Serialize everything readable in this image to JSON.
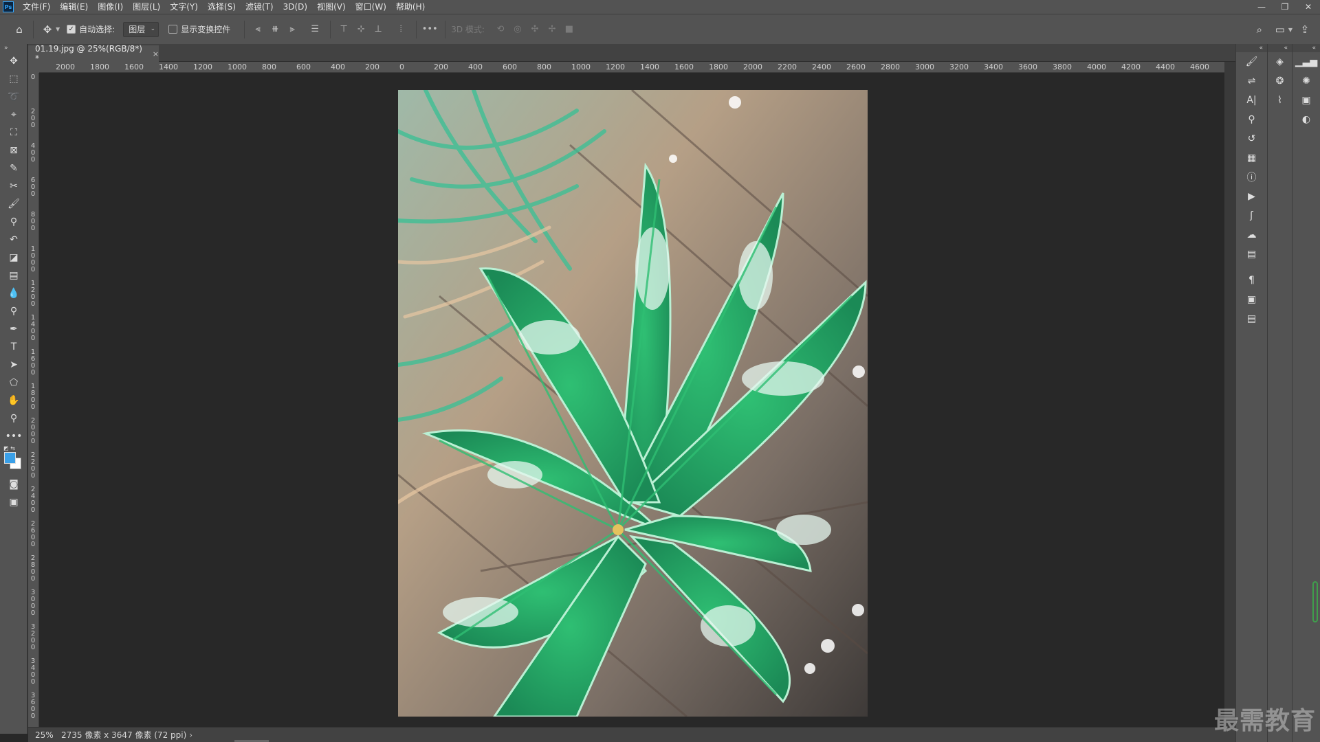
{
  "app": {
    "logo": "Ps"
  },
  "menu": [
    "文件(F)",
    "编辑(E)",
    "图像(I)",
    "图层(L)",
    "文字(Y)",
    "选择(S)",
    "滤镜(T)",
    "3D(D)",
    "视图(V)",
    "窗口(W)",
    "帮助(H)"
  ],
  "options": {
    "auto_select_label": "自动选择:",
    "auto_select_checked": true,
    "layer_select_value": "图层",
    "show_transform_label": "显示变换控件",
    "show_transform_checked": false,
    "mode_3d_label": "3D 模式:"
  },
  "document": {
    "tab_title": "01.19.jpg @ 25%(RGB/8*) *",
    "zoom": "25%",
    "status_info": "2735 像素 x 3647 像素 (72 ppi)"
  },
  "ruler": {
    "top_labels": [
      "2000",
      "1800",
      "1600",
      "1400",
      "1200",
      "1000",
      "800",
      "600",
      "400",
      "200",
      "0",
      "200",
      "400",
      "600",
      "800",
      "1000",
      "1200",
      "1400",
      "1600",
      "1800",
      "2000",
      "2200",
      "2400",
      "2600",
      "2800",
      "3000",
      "3200",
      "3400",
      "3600",
      "3800",
      "4000",
      "4200",
      "4400",
      "4600"
    ],
    "left_labels": [
      "0",
      "200",
      "400",
      "600",
      "800",
      "1000",
      "1200",
      "1400",
      "1600",
      "1800",
      "2000",
      "2200",
      "2400",
      "2600",
      "2800",
      "3000",
      "3200",
      "3400",
      "3600"
    ]
  },
  "colors": {
    "foreground": "#3aa0e8",
    "background": "#ffffff",
    "ui_bg": "#535353",
    "canvas_bg": "#282828"
  },
  "watermark": "最需教育"
}
